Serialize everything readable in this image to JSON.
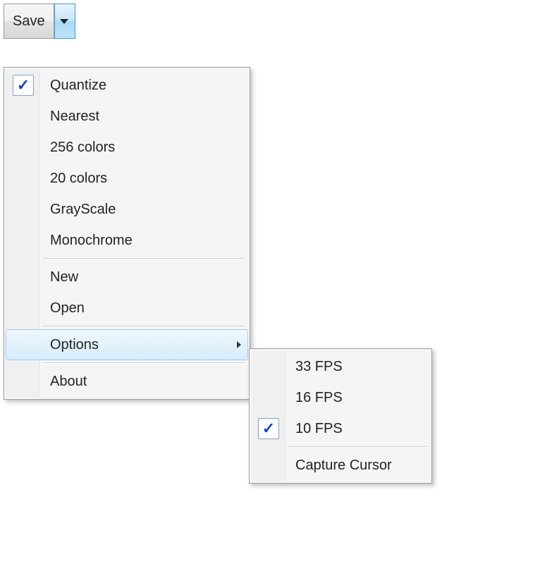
{
  "toolbar": {
    "save_label": "Save"
  },
  "menu": {
    "items": [
      {
        "label": "Quantize",
        "checked": true
      },
      {
        "label": "Nearest"
      },
      {
        "label": "256 colors"
      },
      {
        "label": "20 colors"
      },
      {
        "label": "GrayScale"
      },
      {
        "label": "Monochrome"
      },
      {
        "type": "separator"
      },
      {
        "label": "New"
      },
      {
        "label": "Open"
      },
      {
        "type": "separator"
      },
      {
        "label": "Options",
        "submenu": true,
        "highlighted": true
      },
      {
        "type": "separator"
      },
      {
        "label": "About"
      }
    ]
  },
  "submenu": {
    "items": [
      {
        "label": "33 FPS"
      },
      {
        "label": "16 FPS"
      },
      {
        "label": "10 FPS",
        "checked": true
      },
      {
        "type": "separator"
      },
      {
        "label": "Capture Cursor"
      }
    ]
  }
}
